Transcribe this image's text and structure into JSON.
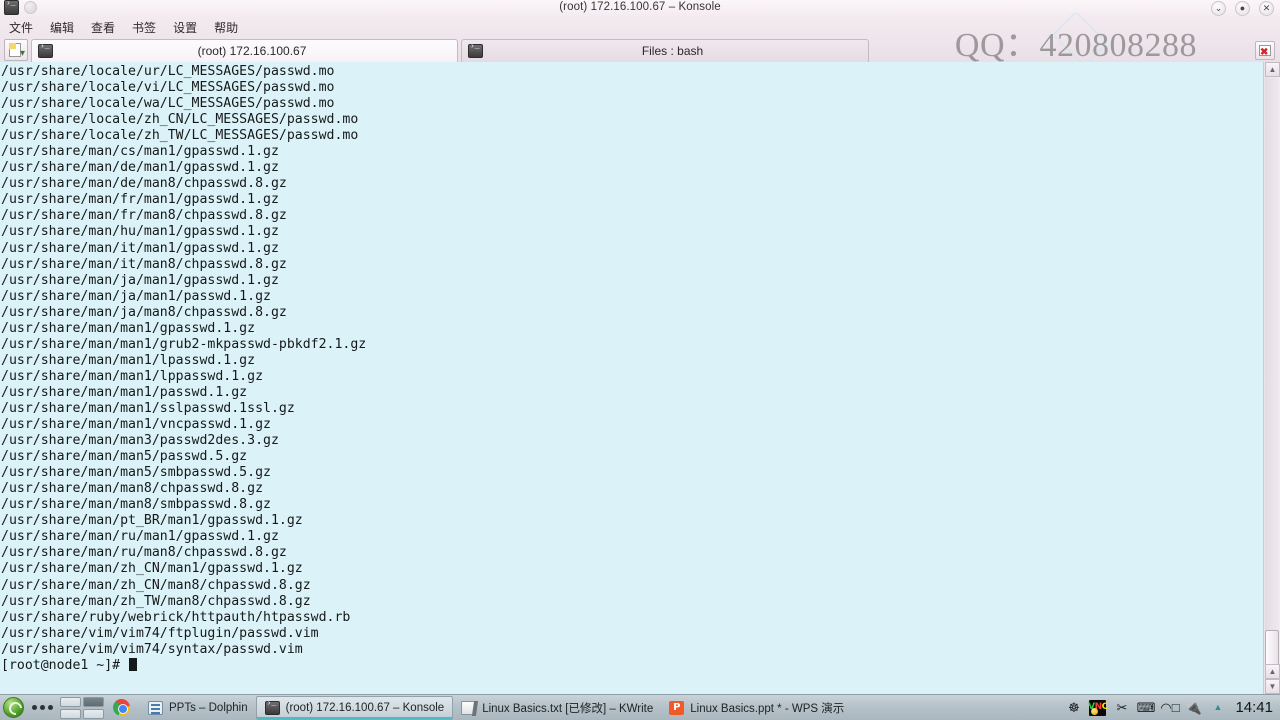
{
  "window": {
    "title": "(root) 172.16.100.67 – Konsole",
    "buttons": {
      "minimize": "⌄",
      "maximize": "●",
      "close": "✕"
    }
  },
  "menubar": {
    "items": [
      {
        "label": "文件"
      },
      {
        "label": "编辑"
      },
      {
        "label": "查看"
      },
      {
        "label": "书签"
      },
      {
        "label": "设置"
      },
      {
        "label": "帮助"
      }
    ]
  },
  "tabs": [
    {
      "label": "(root) 172.16.100.67",
      "active": true
    },
    {
      "label": "Files : bash",
      "active": false
    }
  ],
  "watermark": {
    "text": "QQ：420808288"
  },
  "terminal": {
    "lines": [
      "/usr/share/locale/ur/LC_MESSAGES/passwd.mo",
      "/usr/share/locale/vi/LC_MESSAGES/passwd.mo",
      "/usr/share/locale/wa/LC_MESSAGES/passwd.mo",
      "/usr/share/locale/zh_CN/LC_MESSAGES/passwd.mo",
      "/usr/share/locale/zh_TW/LC_MESSAGES/passwd.mo",
      "/usr/share/man/cs/man1/gpasswd.1.gz",
      "/usr/share/man/de/man1/gpasswd.1.gz",
      "/usr/share/man/de/man8/chpasswd.8.gz",
      "/usr/share/man/fr/man1/gpasswd.1.gz",
      "/usr/share/man/fr/man8/chpasswd.8.gz",
      "/usr/share/man/hu/man1/gpasswd.1.gz",
      "/usr/share/man/it/man1/gpasswd.1.gz",
      "/usr/share/man/it/man8/chpasswd.8.gz",
      "/usr/share/man/ja/man1/gpasswd.1.gz",
      "/usr/share/man/ja/man1/passwd.1.gz",
      "/usr/share/man/ja/man8/chpasswd.8.gz",
      "/usr/share/man/man1/gpasswd.1.gz",
      "/usr/share/man/man1/grub2-mkpasswd-pbkdf2.1.gz",
      "/usr/share/man/man1/lpasswd.1.gz",
      "/usr/share/man/man1/lppasswd.1.gz",
      "/usr/share/man/man1/passwd.1.gz",
      "/usr/share/man/man1/sslpasswd.1ssl.gz",
      "/usr/share/man/man1/vncpasswd.1.gz",
      "/usr/share/man/man3/passwd2des.3.gz",
      "/usr/share/man/man5/passwd.5.gz",
      "/usr/share/man/man5/smbpasswd.5.gz",
      "/usr/share/man/man8/chpasswd.8.gz",
      "/usr/share/man/man8/smbpasswd.8.gz",
      "/usr/share/man/pt_BR/man1/gpasswd.1.gz",
      "/usr/share/man/ru/man1/gpasswd.1.gz",
      "/usr/share/man/ru/man8/chpasswd.8.gz",
      "/usr/share/man/zh_CN/man1/gpasswd.1.gz",
      "/usr/share/man/zh_CN/man8/chpasswd.8.gz",
      "/usr/share/man/zh_TW/man8/chpasswd.8.gz",
      "/usr/share/ruby/webrick/httpauth/htpasswd.rb",
      "/usr/share/vim/vim74/ftplugin/passwd.vim",
      "/usr/share/vim/vim74/syntax/passwd.vim"
    ],
    "prompt": "[root@node1 ~]# ",
    "background_color": "#dbf3f8",
    "text_color": "#16191a"
  },
  "taskbar": {
    "tasks": [
      {
        "label": "PPTs – Dolphin",
        "icon": "dolphin-icon",
        "active": false
      },
      {
        "label": "(root) 172.16.100.67 – Konsole",
        "icon": "konsole-icon",
        "active": true
      },
      {
        "label": "Linux Basics.txt [已修改] – KWrite",
        "icon": "kwrite-icon",
        "active": false
      },
      {
        "label": "Linux Basics.ppt * - WPS 演示",
        "icon": "wps-icon",
        "active": false
      }
    ],
    "tray": [
      {
        "name": "bug-icon",
        "glyph": "☸"
      },
      {
        "name": "vnc-icon",
        "glyph": "VNC"
      },
      {
        "name": "scissors-icon",
        "glyph": "✂"
      },
      {
        "name": "keyboard-icon",
        "glyph": "⌨"
      },
      {
        "name": "clipboard-icon",
        "glyph": "⏺"
      },
      {
        "name": "plug-icon",
        "glyph": "🔌"
      },
      {
        "name": "expand-arrow-icon",
        "glyph": "▲"
      }
    ],
    "clock": "14:41",
    "wps_icon_letter": "P"
  }
}
